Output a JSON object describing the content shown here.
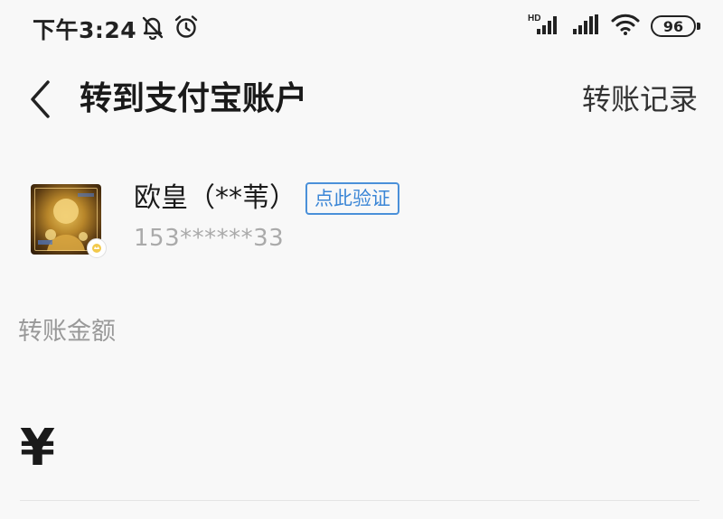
{
  "status_bar": {
    "time": "下午3:24",
    "battery": "96",
    "icons": [
      "mute-bell-icon",
      "alarm-icon",
      "hd-signal-icon",
      "signal-icon",
      "wifi-icon",
      "battery-icon"
    ]
  },
  "header": {
    "title": "转到支付宝账户",
    "records_label": "转账记录",
    "back_icon": "chevron-left-icon"
  },
  "recipient": {
    "name": "欧皇（**苇）",
    "verify_label": "点此验证",
    "phone": "153******33"
  },
  "amount": {
    "label": "转账金额",
    "currency": "¥",
    "value": ""
  },
  "colors": {
    "background": "#f8f8f8",
    "verify_blue": "#3b86d6",
    "muted_text": "#999999"
  }
}
